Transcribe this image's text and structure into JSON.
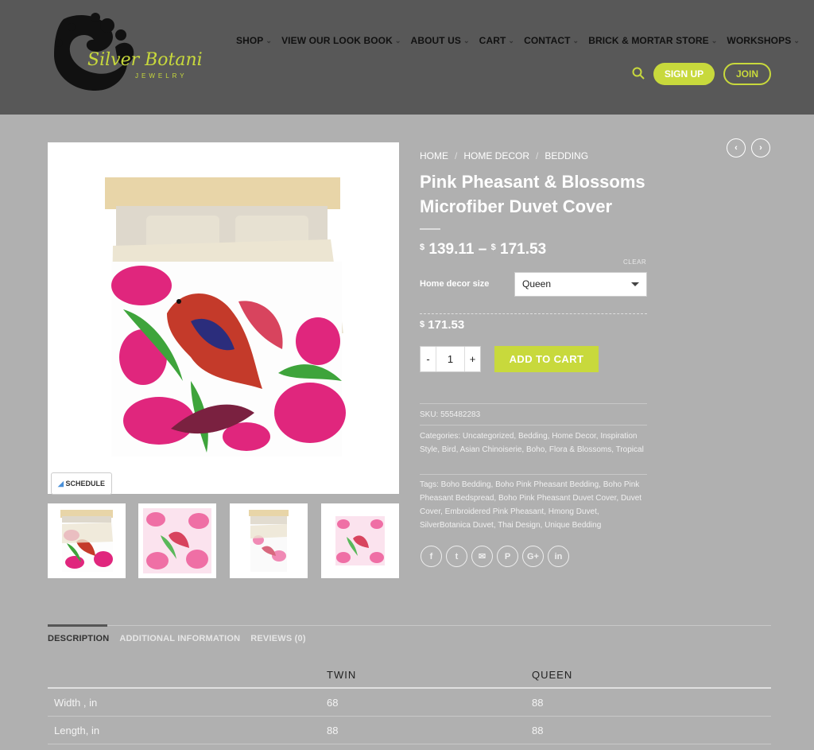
{
  "header": {
    "logo_text": "Silver Botanica",
    "logo_subtext": "JEWELRY",
    "nav": [
      {
        "label": "SHOP"
      },
      {
        "label": "VIEW OUR LOOK BOOK"
      },
      {
        "label": "ABOUT US"
      },
      {
        "label": "CART"
      },
      {
        "label": "CONTACT"
      },
      {
        "label": "BRICK & MORTAR STORE"
      },
      {
        "label": "WORKSHOPS"
      }
    ],
    "signup_label": "SIGN UP",
    "join_label": "JOIN",
    "accent_color": "#c8d93c"
  },
  "gallery": {
    "schedule_label": "SCHEDULE",
    "thumbnails": [
      "bed-thumbnail",
      "pattern-thumbnail",
      "pillow-thumbnail",
      "square-thumbnail"
    ]
  },
  "breadcrumb": [
    "HOME",
    "HOME DECOR",
    "BEDDING"
  ],
  "product": {
    "title": "Pink Pheasant & Blossoms Microfiber Duvet Cover",
    "currency": "$",
    "price_min": "139.11",
    "price_dash": "–",
    "price_max": "171.53",
    "clear_label": "CLEAR",
    "variant_label": "Home decor size",
    "variant_selected": "Queen",
    "selected_price": "171.53",
    "qty_minus": "-",
    "qty_value": "1",
    "qty_plus": "+",
    "add_to_cart": "ADD TO CART",
    "sku": "SKU: 555482283",
    "categories": "Categories: Uncategorized, Bedding, Home Decor, Inspiration Style, Bird, Asian Chinoiserie, Boho, Flora & Blossoms, Tropical",
    "tags": "Tags: Boho Bedding, Boho Pink Pheasant Bedding, Boho Pink Pheasant Bedspread, Boho Pink Pheasant Duvet Cover, Duvet Cover, Embroidered Pink Pheasant, Hmong Duvet, SilverBotanica Duvet, Thai Design, Unique Bedding"
  },
  "share_icons": [
    "facebook-icon",
    "twitter-icon",
    "email-icon",
    "pinterest-icon",
    "google-plus-icon",
    "linkedin-icon"
  ],
  "share_glyphs": [
    "f",
    "t",
    "✉",
    "P",
    "G+",
    "in"
  ],
  "tabs": [
    {
      "label": "DESCRIPTION",
      "active": true
    },
    {
      "label": "ADDITIONAL INFORMATION",
      "active": false
    },
    {
      "label": "REVIEWS (0)",
      "active": false
    }
  ],
  "spec_table": {
    "headers": [
      "",
      "TWIN",
      "QUEEN"
    ],
    "rows": [
      [
        "Width , in",
        "68",
        "88"
      ],
      [
        "Length, in",
        "88",
        "88"
      ]
    ]
  }
}
